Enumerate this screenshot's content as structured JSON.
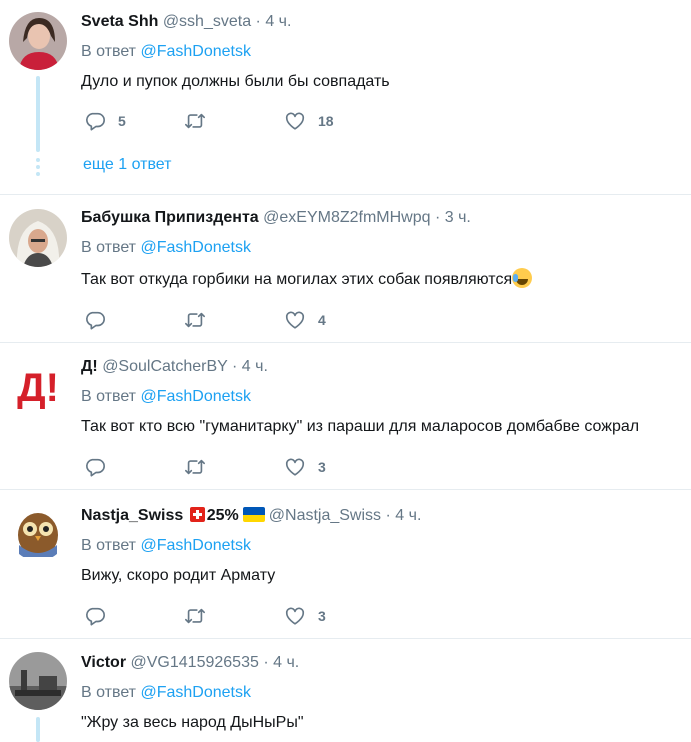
{
  "icons": {
    "reply": "reply-icon",
    "retweet": "retweet-icon",
    "like": "heart-icon"
  },
  "colors": {
    "link": "#1da1f2",
    "muted": "#657786",
    "thread": "#c4e6f6"
  },
  "reply_prefix": "В ответ",
  "reply_mention": "@FashDonetsk",
  "tweets": [
    {
      "name": "Sveta Shh",
      "handle": "@ssh_sveta",
      "dot": "·",
      "time": "4 ч.",
      "text": "Дуло и пупок должны были бы совпадать",
      "reply_count": "5",
      "retweet_count": "",
      "like_count": "18",
      "more_replies": "еще 1 ответ"
    },
    {
      "name": "Бабушка Припиздента",
      "handle": "@exEYM8Z2fmMHwpq",
      "dot": "·",
      "time": "3 ч.",
      "text": "Так вот откуда горбики на могилах этих собак появляются",
      "reply_count": "",
      "retweet_count": "",
      "like_count": "4"
    },
    {
      "name": "Д!",
      "handle": "@SoulCatcherBY",
      "dot": "·",
      "time": "4 ч.",
      "avatar_text": "Д!",
      "text": "Так вот кто всю \"гуманитарку\" из параши для маларосов домбабве сожрал",
      "reply_count": "",
      "retweet_count": "",
      "like_count": "3"
    },
    {
      "name": "Nastja_Swiss",
      "name_suffix": "25%",
      "handle": "@Nastja_Swiss",
      "dot": "·",
      "time": "4 ч.",
      "text": "Вижу, скоро родит Армату",
      "reply_count": "",
      "retweet_count": "",
      "like_count": "3"
    },
    {
      "name": "Victor",
      "handle": "@VG1415926535",
      "dot": "·",
      "time": "4 ч.",
      "text": "\"Жру за весь народ ДыНыРы\""
    }
  ]
}
